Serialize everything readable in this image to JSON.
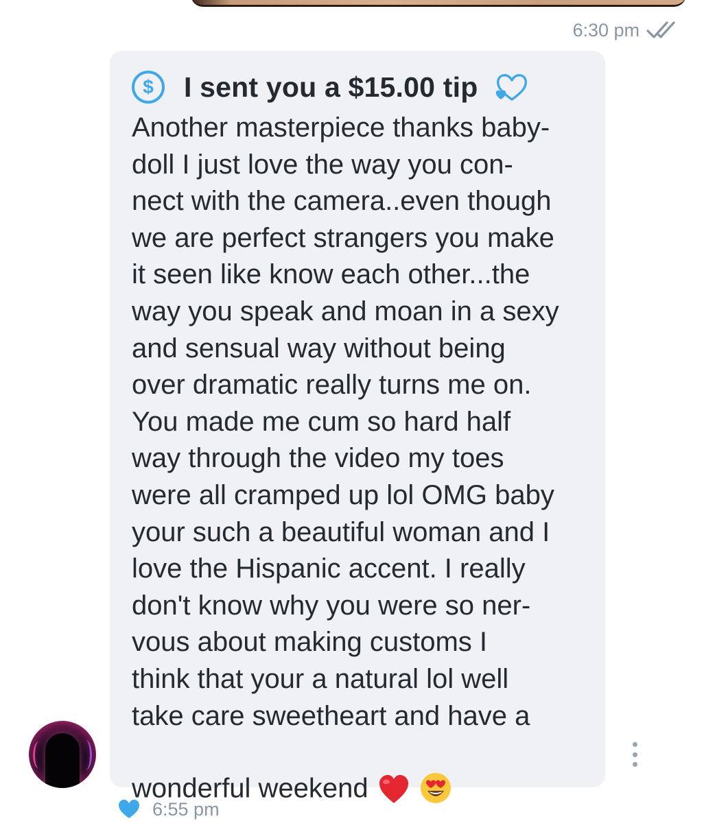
{
  "previous_message": {
    "time": "6:30 pm",
    "read_icon": "double-check-icon"
  },
  "tip_message": {
    "icon": "dollar-circle-icon",
    "tip_label": "I sent you a $15.00 tip",
    "tip_icon": "hearts-icon",
    "body": "Another masterpiece thanks baby-\ndoll I just love the way you con-\nnect with the camera..even though\nwe are perfect strangers you make\nit seen like know each other...the\nway you speak and moan in a sexy\nand sensual way without being\nover dramatic really turns me on.\nYou made me cum so hard half\nway through the video my toes\nwere all cramped up lol OMG baby\nyour such a beautiful woman and I\nlove the Hispanic accent. I really\ndon't know why you were so ner-\nvous about making customs I\nthink that your a natural lol well\ntake care sweetheart and have a\nwonderful weekend",
    "emojis": [
      "❤️",
      "😍"
    ],
    "time": "6:55 pm",
    "liked_icon": "heart-icon",
    "more_icon": "more-vertical-icon"
  },
  "colors": {
    "accent": "#3ea8e8",
    "bubble_bg": "#eff1f4",
    "text": "#242a30",
    "meta_text": "#8a96a3"
  }
}
